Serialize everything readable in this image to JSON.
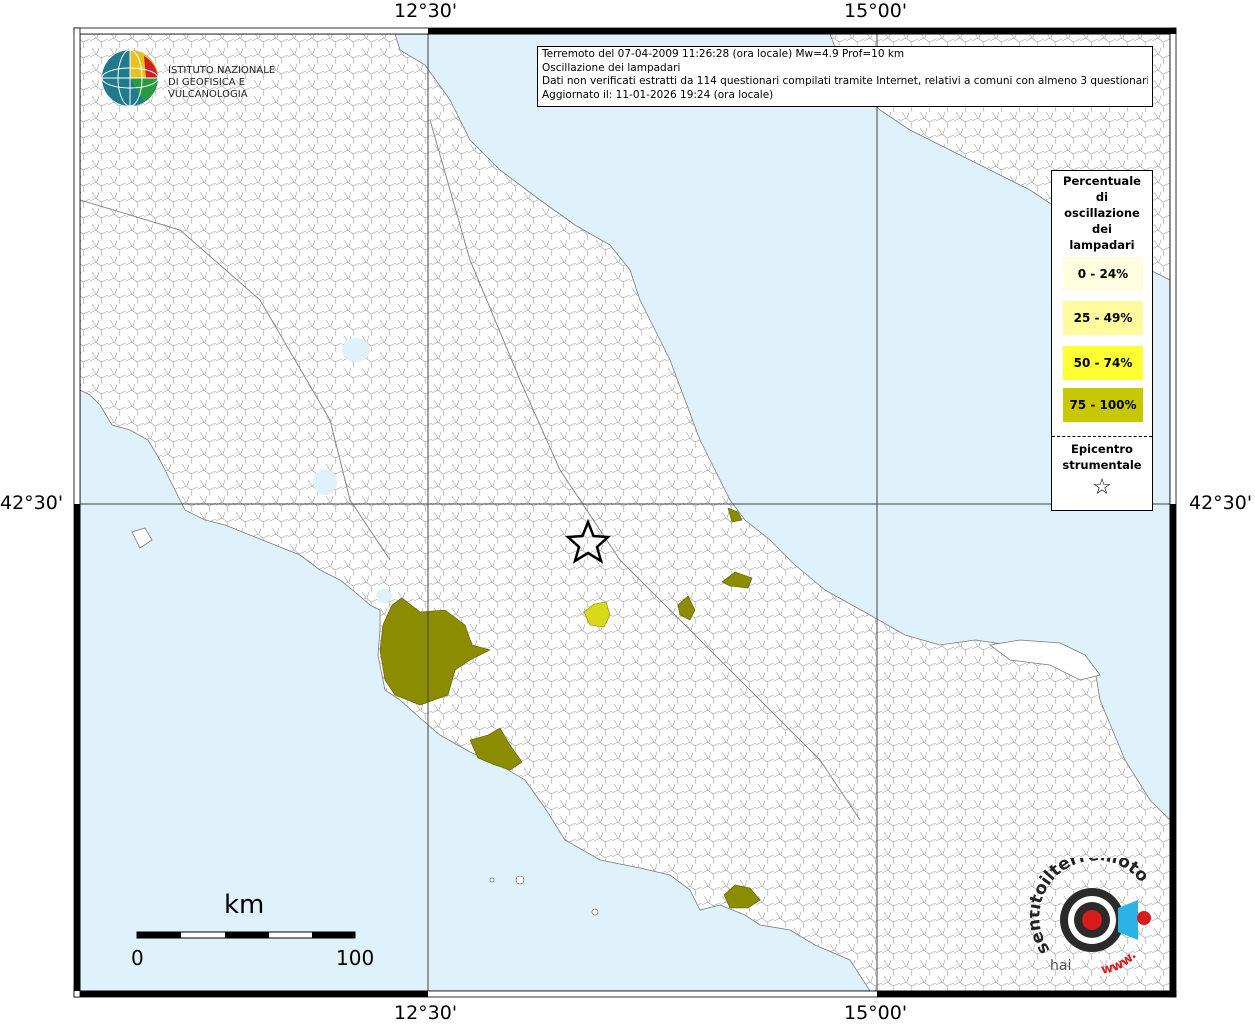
{
  "map": {
    "coord_labels": {
      "top": [
        "12°30'",
        "15°00'"
      ],
      "bottom": [
        "12°30'",
        "15°00'"
      ],
      "left": "42°30'",
      "right": "42°30'"
    },
    "colors": {
      "sea": "#dff1fb",
      "land": "#ffffff",
      "border": "#7a7a7a",
      "class_0_24": "#fffde0",
      "class_25_49": "#fffa9e",
      "class_50_74": "#ffff33",
      "class_75_100": "#8c8c00",
      "yellow_area": "#d9d91a"
    }
  },
  "logo": {
    "line1": "ISTITUTO NAZIONALE",
    "line2": "DI GEOFISICA E VULCANOLOGIA"
  },
  "info": {
    "line1": "Terremoto del 07-04-2009 11:26:28 (ora locale) Mw=4.9 Prof=10 km",
    "line2": "Oscillazione dei lampadari",
    "line3": "Dati non verificati estratti da 114 questionari compilati tramite Internet, relativi a comuni con almeno 3 questionari.",
    "line4": "Aggiornato il: 11-01-2026 19:24 (ora locale)"
  },
  "legend": {
    "title_lines": [
      "Percentuale",
      "di",
      "oscillazione",
      "dei",
      "lampadari"
    ],
    "classes": [
      {
        "label": "0 - 24%",
        "color": "#fffde0"
      },
      {
        "label": "25 - 49%",
        "color": "#fffa9e"
      },
      {
        "label": "50 - 74%",
        "color": "#ffff33"
      },
      {
        "label": "75 - 100%",
        "color": "#c8c800"
      }
    ],
    "epicenter_lines": [
      "Epicentro",
      "strumentale"
    ],
    "epicenter_symbol": "☆"
  },
  "scale": {
    "unit": "km",
    "start": "0",
    "end": "100"
  },
  "haisentito": {
    "text_top": "sentitoilterremoto.it",
    "text_prefix": "hai",
    "text_bottom": "www."
  }
}
